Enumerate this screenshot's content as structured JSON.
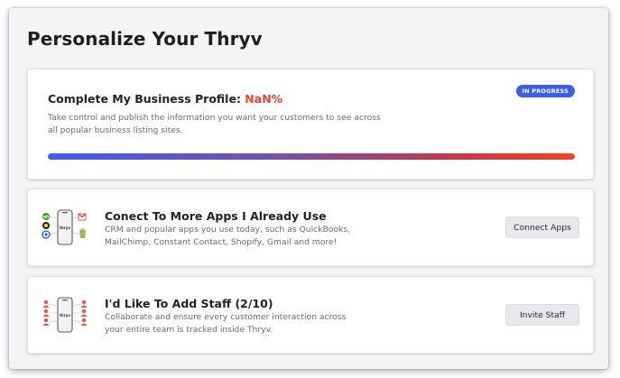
{
  "page": {
    "title": "Personalize Your Thryv"
  },
  "profile": {
    "title_prefix": "Complete My Business Profile: ",
    "percent_text": "NaN%",
    "badge": "IN PROGRESS",
    "description": "Take control and publish the information you want your customers to see across all popular business listing sites.",
    "progress_fraction": 1.0
  },
  "apps": {
    "title": "Conect To More Apps I Already Use",
    "description": "CRM and popular apps you use today, such as QuickBooks, MailChimp, Constant Contact, Shopify, Gmail and more!",
    "button": "Connect Apps",
    "icon": "apps-integration-icon"
  },
  "staff": {
    "title": "I'd Like To Add Staff (2/10)",
    "description": "Collaborate and ensure every customer interaction across your entire team is tracked inside Thryv.",
    "button": "Invite Staff",
    "icon": "staff-team-icon"
  },
  "colors": {
    "badge_blue": "#3b5de7",
    "percent_red": "#e4462f",
    "progress_start": "#3d5ef0",
    "progress_end": "#f24520"
  }
}
